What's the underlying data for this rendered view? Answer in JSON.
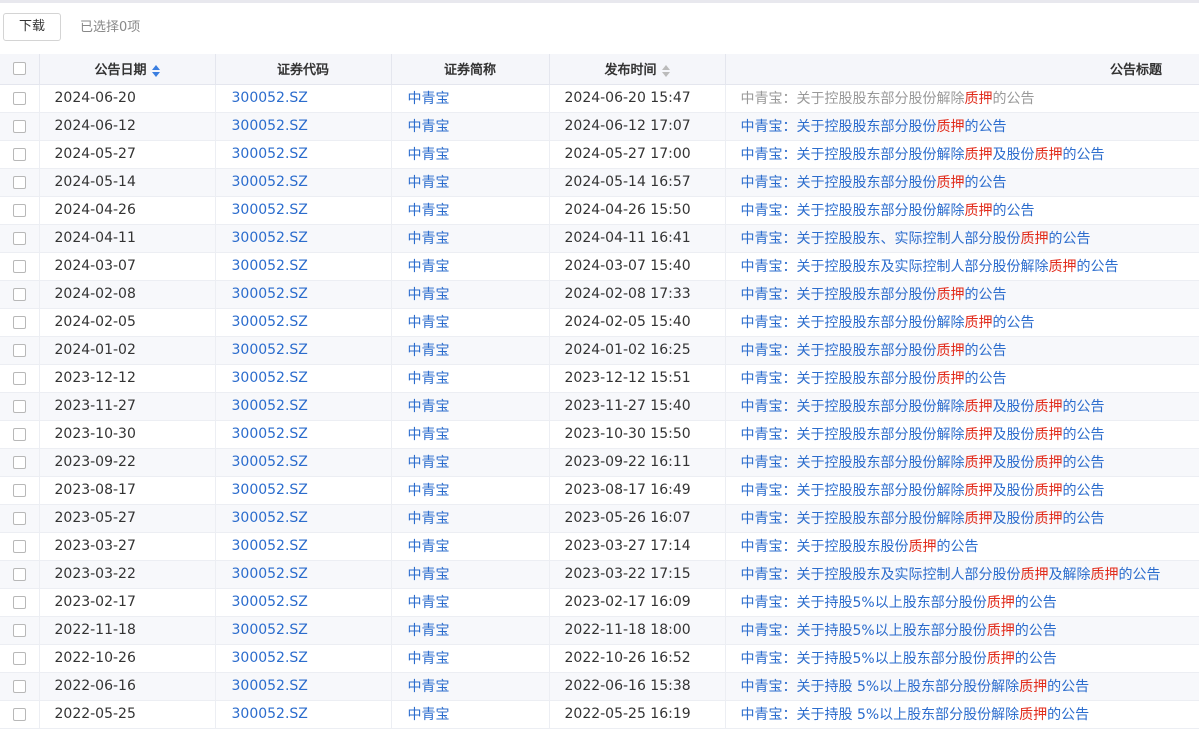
{
  "toolbar": {
    "download_label": "下载",
    "selected_text": "已选择0项"
  },
  "columns": {
    "date": "公告日期",
    "code": "证券代码",
    "name": "证券简称",
    "pub": "发布时间",
    "title": "公告标题"
  },
  "sort": {
    "date": "active",
    "pub": "inactive"
  },
  "colors": {
    "link": "#2b6ccd",
    "highlight": "#e12a1a",
    "visited": "#999999",
    "header_bg": "#f5f6fa"
  },
  "rows": [
    {
      "date": "2024-06-20",
      "code": "300052.SZ",
      "name": "中青宝",
      "pub": "2024-06-20 15:47",
      "visited": true,
      "title": [
        "中青宝：关于控股股东部分股份解除",
        "质押",
        "的公告"
      ]
    },
    {
      "date": "2024-06-12",
      "code": "300052.SZ",
      "name": "中青宝",
      "pub": "2024-06-12 17:07",
      "title": [
        "中青宝：关于控股股东部分股份",
        "质押",
        "的公告"
      ]
    },
    {
      "date": "2024-05-27",
      "code": "300052.SZ",
      "name": "中青宝",
      "pub": "2024-05-27 17:00",
      "title": [
        "中青宝：关于控股股东部分股份解除",
        "质押",
        "及股份",
        "质押",
        "的公告"
      ]
    },
    {
      "date": "2024-05-14",
      "code": "300052.SZ",
      "name": "中青宝",
      "pub": "2024-05-14 16:57",
      "title": [
        "中青宝：关于控股股东部分股份",
        "质押",
        "的公告"
      ]
    },
    {
      "date": "2024-04-26",
      "code": "300052.SZ",
      "name": "中青宝",
      "pub": "2024-04-26 15:50",
      "title": [
        "中青宝：关于控股股东部分股份解除",
        "质押",
        "的公告"
      ]
    },
    {
      "date": "2024-04-11",
      "code": "300052.SZ",
      "name": "中青宝",
      "pub": "2024-04-11 16:41",
      "title": [
        "中青宝：关于控股股东、实际控制人部分股份",
        "质押",
        "的公告"
      ]
    },
    {
      "date": "2024-03-07",
      "code": "300052.SZ",
      "name": "中青宝",
      "pub": "2024-03-07 15:40",
      "title": [
        "中青宝：关于控股股东及实际控制人部分股份解除",
        "质押",
        "的公告"
      ]
    },
    {
      "date": "2024-02-08",
      "code": "300052.SZ",
      "name": "中青宝",
      "pub": "2024-02-08 17:33",
      "title": [
        "中青宝：关于控股股东部分股份",
        "质押",
        "的公告"
      ]
    },
    {
      "date": "2024-02-05",
      "code": "300052.SZ",
      "name": "中青宝",
      "pub": "2024-02-05 15:40",
      "title": [
        "中青宝：关于控股股东部分股份解除",
        "质押",
        "的公告"
      ]
    },
    {
      "date": "2024-01-02",
      "code": "300052.SZ",
      "name": "中青宝",
      "pub": "2024-01-02 16:25",
      "title": [
        "中青宝：关于控股股东部分股份",
        "质押",
        "的公告"
      ]
    },
    {
      "date": "2023-12-12",
      "code": "300052.SZ",
      "name": "中青宝",
      "pub": "2023-12-12 15:51",
      "title": [
        "中青宝：关于控股股东部分股份",
        "质押",
        "的公告"
      ]
    },
    {
      "date": "2023-11-27",
      "code": "300052.SZ",
      "name": "中青宝",
      "pub": "2023-11-27 15:40",
      "title": [
        "中青宝：关于控股股东部分股份解除",
        "质押",
        "及股份",
        "质押",
        "的公告"
      ]
    },
    {
      "date": "2023-10-30",
      "code": "300052.SZ",
      "name": "中青宝",
      "pub": "2023-10-30 15:50",
      "title": [
        "中青宝：关于控股股东部分股份解除",
        "质押",
        "及股份",
        "质押",
        "的公告"
      ]
    },
    {
      "date": "2023-09-22",
      "code": "300052.SZ",
      "name": "中青宝",
      "pub": "2023-09-22 16:11",
      "title": [
        "中青宝：关于控股股东部分股份解除",
        "质押",
        "及股份",
        "质押",
        "的公告"
      ]
    },
    {
      "date": "2023-08-17",
      "code": "300052.SZ",
      "name": "中青宝",
      "pub": "2023-08-17 16:49",
      "title": [
        "中青宝：关于控股股东部分股份解除",
        "质押",
        "及股份",
        "质押",
        "的公告"
      ]
    },
    {
      "date": "2023-05-27",
      "code": "300052.SZ",
      "name": "中青宝",
      "pub": "2023-05-26 16:07",
      "title": [
        "中青宝：关于控股股东部分股份解除",
        "质押",
        "及股份",
        "质押",
        "的公告"
      ]
    },
    {
      "date": "2023-03-27",
      "code": "300052.SZ",
      "name": "中青宝",
      "pub": "2023-03-27 17:14",
      "title": [
        "中青宝：关于控股股东股份",
        "质押",
        "的公告"
      ]
    },
    {
      "date": "2023-03-22",
      "code": "300052.SZ",
      "name": "中青宝",
      "pub": "2023-03-22 17:15",
      "title": [
        "中青宝：关于控股股东及实际控制人部分股份",
        "质押",
        "及解除",
        "质押",
        "的公告"
      ]
    },
    {
      "date": "2023-02-17",
      "code": "300052.SZ",
      "name": "中青宝",
      "pub": "2023-02-17 16:09",
      "title": [
        "中青宝：关于持股5%以上股东部分股份",
        "质押",
        "的公告"
      ]
    },
    {
      "date": "2022-11-18",
      "code": "300052.SZ",
      "name": "中青宝",
      "pub": "2022-11-18 18:00",
      "title": [
        "中青宝：关于持股5%以上股东部分股份",
        "质押",
        "的公告"
      ]
    },
    {
      "date": "2022-10-26",
      "code": "300052.SZ",
      "name": "中青宝",
      "pub": "2022-10-26 16:52",
      "title": [
        "中青宝：关于持股5%以上股东部分股份",
        "质押",
        "的公告"
      ]
    },
    {
      "date": "2022-06-16",
      "code": "300052.SZ",
      "name": "中青宝",
      "pub": "2022-06-16 15:38",
      "title": [
        "中青宝：关于持股 5%以上股东部分股份解除",
        "质押",
        "的公告"
      ]
    },
    {
      "date": "2022-05-25",
      "code": "300052.SZ",
      "name": "中青宝",
      "pub": "2022-05-25 16:19",
      "title": [
        "中青宝：关于持股 5%以上股东部分股份解除",
        "质押",
        "的公告"
      ]
    }
  ]
}
